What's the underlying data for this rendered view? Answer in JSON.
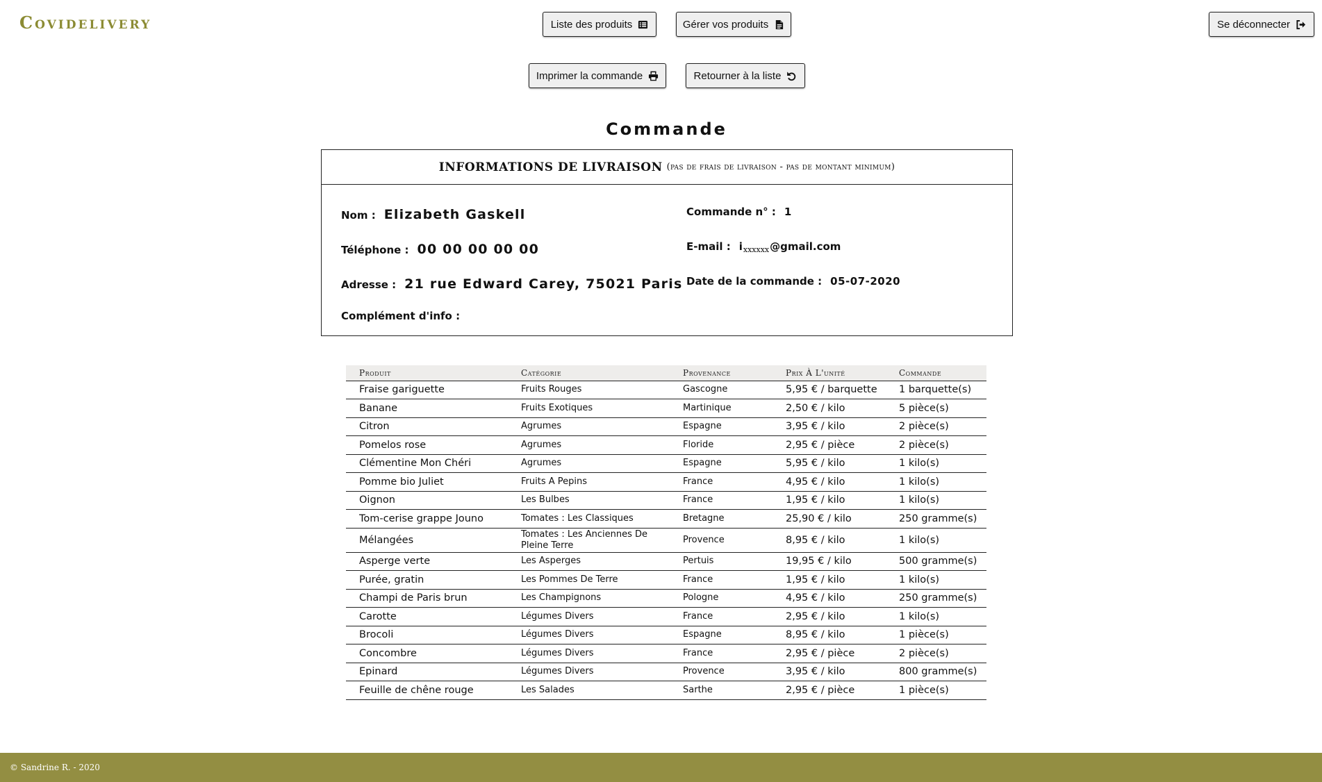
{
  "brand": "Covidelivery",
  "nav": {
    "list_label": "Liste des produits",
    "manage_label": "Gérer vos produits",
    "logout_label": "Se déconnecter"
  },
  "actions": {
    "print_label": "Imprimer la commande",
    "back_label": "Retourner à la liste"
  },
  "page_title": "Commande",
  "delivery": {
    "header_main": "INFORMATIONS DE LIVRAISON",
    "header_sub": "(pas de frais de livraison - pas de montant minimum)",
    "name_label": "Nom :",
    "name_value": "Elizabeth Gaskell",
    "phone_label": "Téléphone :",
    "phone_value": "00 00 00 00 00",
    "address_label": "Adresse :",
    "address_value": "21 rue Edward Carey, 75021 Paris",
    "extra_label": "Complément d'info :",
    "extra_value": "",
    "order_no_label": "Commande n° :",
    "order_no_value": "1",
    "email_label": "E-mail :",
    "email_prefix": "i",
    "email_mask": "xxxxxx",
    "email_domain": "@gmail.com",
    "date_label": "Date de la commande :",
    "date_value": "05-07-2020"
  },
  "table": {
    "headers": [
      "Produit",
      "Catégorie",
      "Provenance",
      "Prix À L'unité",
      "Commande"
    ],
    "rows": [
      {
        "product": "Fraise gariguette",
        "category": "Fruits Rouges",
        "origin": "Gascogne",
        "price": "5,95 € / barquette",
        "order": "1 barquette(s)"
      },
      {
        "product": "Banane",
        "category": "Fruits Exotiques",
        "origin": "Martinique",
        "price": "2,50 € / kilo",
        "order": "5 pièce(s)"
      },
      {
        "product": "Citron",
        "category": "Agrumes",
        "origin": "Espagne",
        "price": "3,95 € / kilo",
        "order": "2 pièce(s)"
      },
      {
        "product": "Pomelos rose",
        "category": "Agrumes",
        "origin": "Floride",
        "price": "2,95 € / pièce",
        "order": "2 pièce(s)"
      },
      {
        "product": "Clémentine Mon Chéri",
        "category": "Agrumes",
        "origin": "Espagne",
        "price": "5,95 € / kilo",
        "order": "1 kilo(s)"
      },
      {
        "product": "Pomme bio Juliet",
        "category": "Fruits A Pepins",
        "origin": "France",
        "price": "4,95 € / kilo",
        "order": "1 kilo(s)"
      },
      {
        "product": "Oignon",
        "category": "Les Bulbes",
        "origin": "France",
        "price": "1,95 € / kilo",
        "order": "1 kilo(s)"
      },
      {
        "product": "Tom-cerise grappe Jouno",
        "category": "Tomates : Les Classiques",
        "origin": "Bretagne",
        "price": "25,90 € / kilo",
        "order": "250 gramme(s)"
      },
      {
        "product": "Mélangées",
        "category": "Tomates : Les Anciennes De Pleine Terre",
        "origin": "Provence",
        "price": "8,95 € / kilo",
        "order": "1 kilo(s)"
      },
      {
        "product": "Asperge verte",
        "category": "Les Asperges",
        "origin": "Pertuis",
        "price": "19,95 € / kilo",
        "order": "500 gramme(s)"
      },
      {
        "product": "Purée, gratin",
        "category": "Les Pommes De Terre",
        "origin": "France",
        "price": "1,95 € / kilo",
        "order": "1 kilo(s)"
      },
      {
        "product": "Champi de Paris brun",
        "category": "Les Champignons",
        "origin": "Pologne",
        "price": "4,95 € / kilo",
        "order": "250 gramme(s)"
      },
      {
        "product": "Carotte",
        "category": "Légumes Divers",
        "origin": "France",
        "price": "2,95 € / kilo",
        "order": "1 kilo(s)"
      },
      {
        "product": "Brocoli",
        "category": "Légumes Divers",
        "origin": "Espagne",
        "price": "8,95 € / kilo",
        "order": "1 pièce(s)"
      },
      {
        "product": "Concombre",
        "category": "Légumes Divers",
        "origin": "France",
        "price": "2,95 € / pièce",
        "order": "2 pièce(s)"
      },
      {
        "product": "Epinard",
        "category": "Légumes Divers",
        "origin": "Provence",
        "price": "3,95 € / kilo",
        "order": "800 gramme(s)"
      },
      {
        "product": "Feuille de chêne rouge",
        "category": "Les Salades",
        "origin": "Sarthe",
        "price": "2,95 € / pièce",
        "order": "1 pièce(s)"
      }
    ]
  },
  "footer": "© Sandrine R. - 2020",
  "icons": {
    "list": "list-icon",
    "manage": "file-icon",
    "logout": "sign-out-icon",
    "print": "print-icon",
    "back": "undo-icon"
  },
  "colors": {
    "brand": "#8b8b33",
    "footer_bg": "#938e42",
    "table_header_bg": "#eeedeb",
    "button_bg": "#efefef"
  }
}
